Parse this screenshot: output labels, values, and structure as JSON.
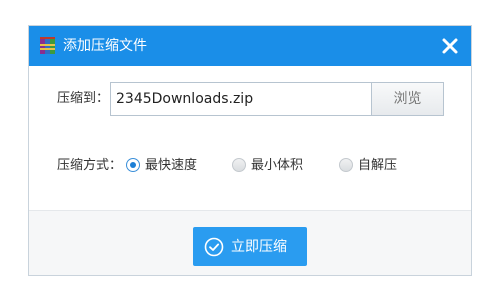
{
  "window": {
    "title": "添加压缩文件",
    "app_icon": "winrar-books-icon",
    "close_icon": "close-icon",
    "accent_color": "#1a8ee8"
  },
  "compress_to": {
    "label": "压缩到：",
    "value": "2345Downloads.zip",
    "browse_label": "浏览"
  },
  "method": {
    "label": "压缩方式：",
    "options": [
      {
        "label": "最快速度",
        "selected": true
      },
      {
        "label": "最小体积",
        "selected": false
      },
      {
        "label": "自解压",
        "selected": false
      }
    ]
  },
  "action": {
    "label": "立即压缩",
    "icon": "check-circle-icon",
    "color": "#2a9cf0"
  }
}
